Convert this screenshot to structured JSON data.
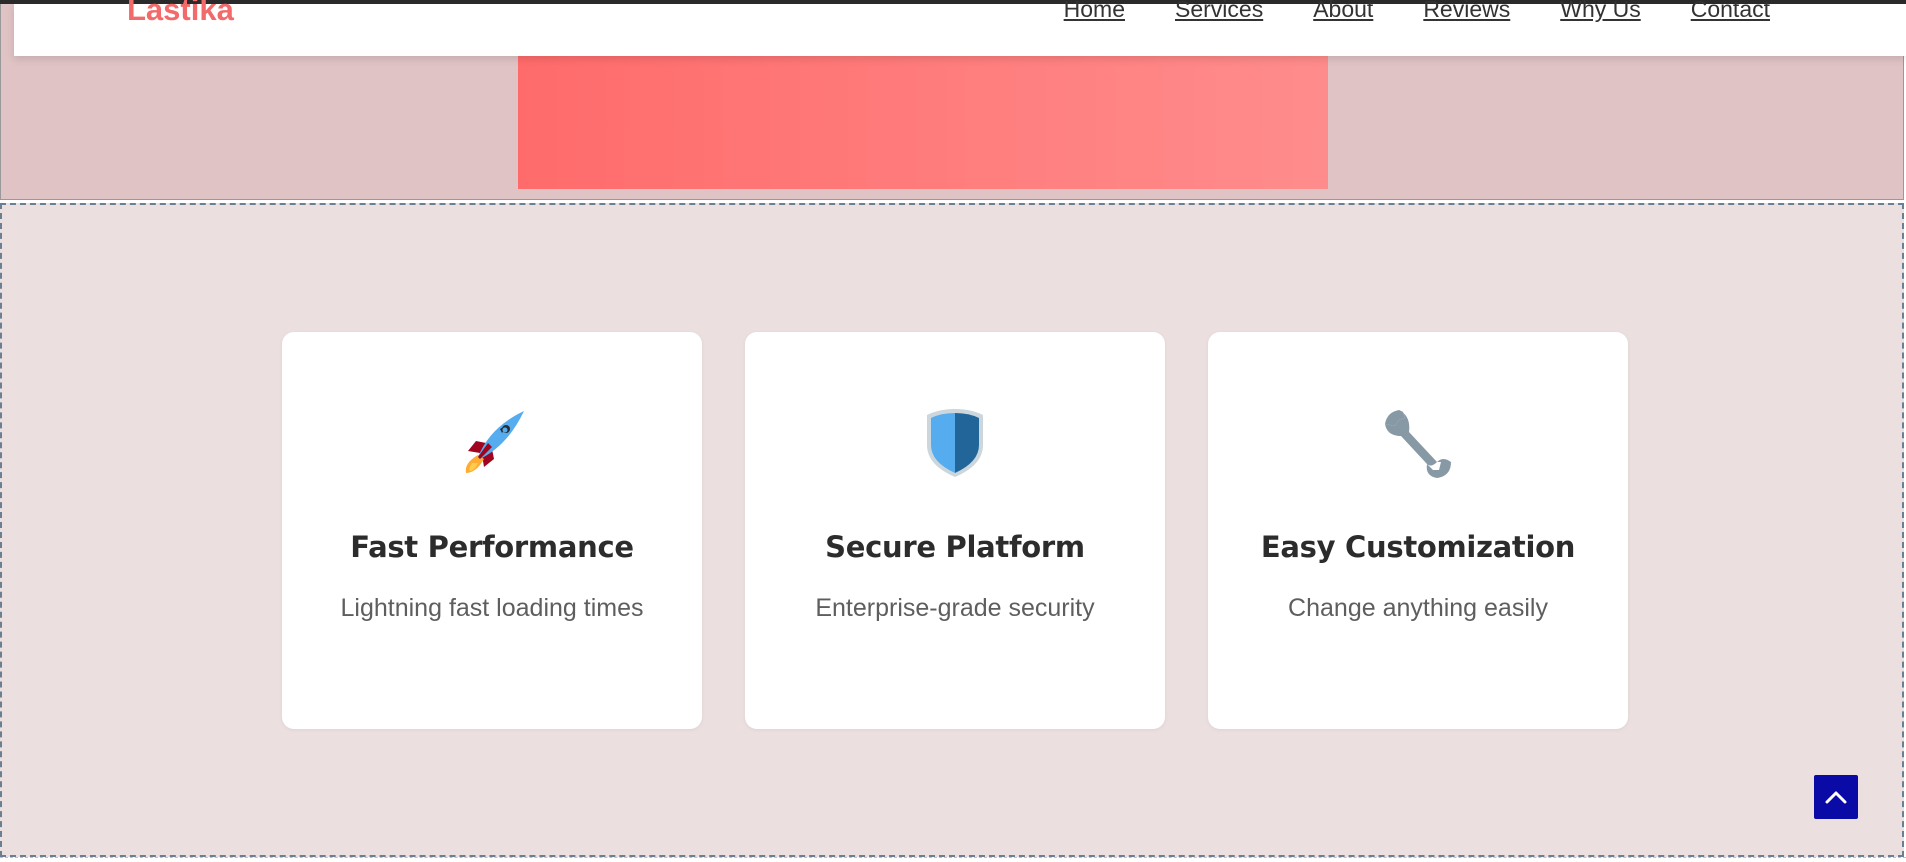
{
  "brand": {
    "name": "Lastika",
    "accent_color": "#f36a6a"
  },
  "nav": {
    "items": [
      "Home",
      "Services",
      "About",
      "Reviews",
      "Why Us",
      "Contact"
    ]
  },
  "features": [
    {
      "icon": "rocket-icon",
      "title": "Fast Performance",
      "description": "Lightning fast loading times"
    },
    {
      "icon": "shield-icon",
      "title": "Secure Platform",
      "description": "Enterprise-grade security"
    },
    {
      "icon": "wrench-icon",
      "title": "Easy Customization",
      "description": "Change anything easily"
    }
  ],
  "back_to_top": {
    "icon": "chevron-up-icon",
    "color": "#0a0aa6"
  }
}
